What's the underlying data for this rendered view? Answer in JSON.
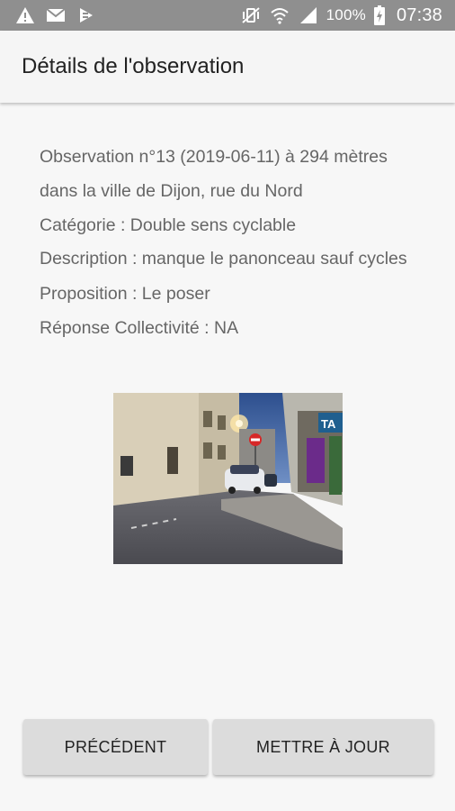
{
  "status_bar": {
    "battery": "100%",
    "time": "07:38",
    "icons_left": [
      "warning-icon",
      "mail-icon",
      "app-notification-icon"
    ],
    "icons_right": [
      "vibrate-mute-icon",
      "wifi-icon",
      "signal-icon",
      "battery-charging-icon"
    ]
  },
  "app_bar": {
    "title": "Détails de l'observation"
  },
  "observation": {
    "line1": "Observation n°13 (2019-06-11) à 294 mètres",
    "line2": "dans la ville de Dijon, rue du Nord",
    "category": "Catégorie : Double sens cyclable",
    "description": "Description : manque le panonceau sauf cycles",
    "proposal": "Proposition : Le poser",
    "response": "Réponse Collectivité : NA"
  },
  "photo": {
    "sign_text": "TA"
  },
  "buttons": {
    "previous": "PRÉCÉDENT",
    "update": "METTRE À JOUR"
  },
  "colors": {
    "status_bar": "#8f8f8f",
    "app_bar": "#f5f5f5",
    "background": "#f7f7f7",
    "button": "#dcdcdc",
    "body_text": "#666666"
  }
}
